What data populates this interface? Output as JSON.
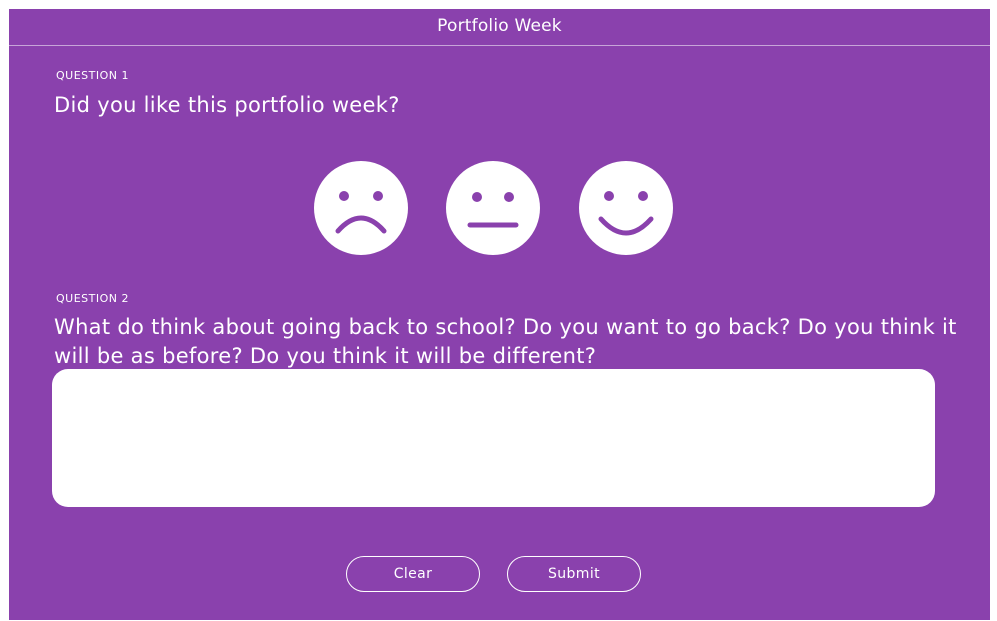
{
  "header": {
    "title": "Portfolio Week"
  },
  "question1": {
    "label": "QUESTION 1",
    "text": "Did you like this portfolio week?",
    "options": [
      {
        "icon": "sad-face-icon"
      },
      {
        "icon": "neutral-face-icon"
      },
      {
        "icon": "happy-face-icon"
      }
    ]
  },
  "question2": {
    "label": "QUESTION 2",
    "text": "What do think about going back to school? Do you want to go back? Do you think it will be as before? Do you think it will be different?",
    "answer_value": "",
    "answer_placeholder": ""
  },
  "buttons": {
    "clear_label": "Clear",
    "submit_label": "Submit"
  },
  "colors": {
    "background": "#8a41ad",
    "foreground": "#ffffff"
  }
}
